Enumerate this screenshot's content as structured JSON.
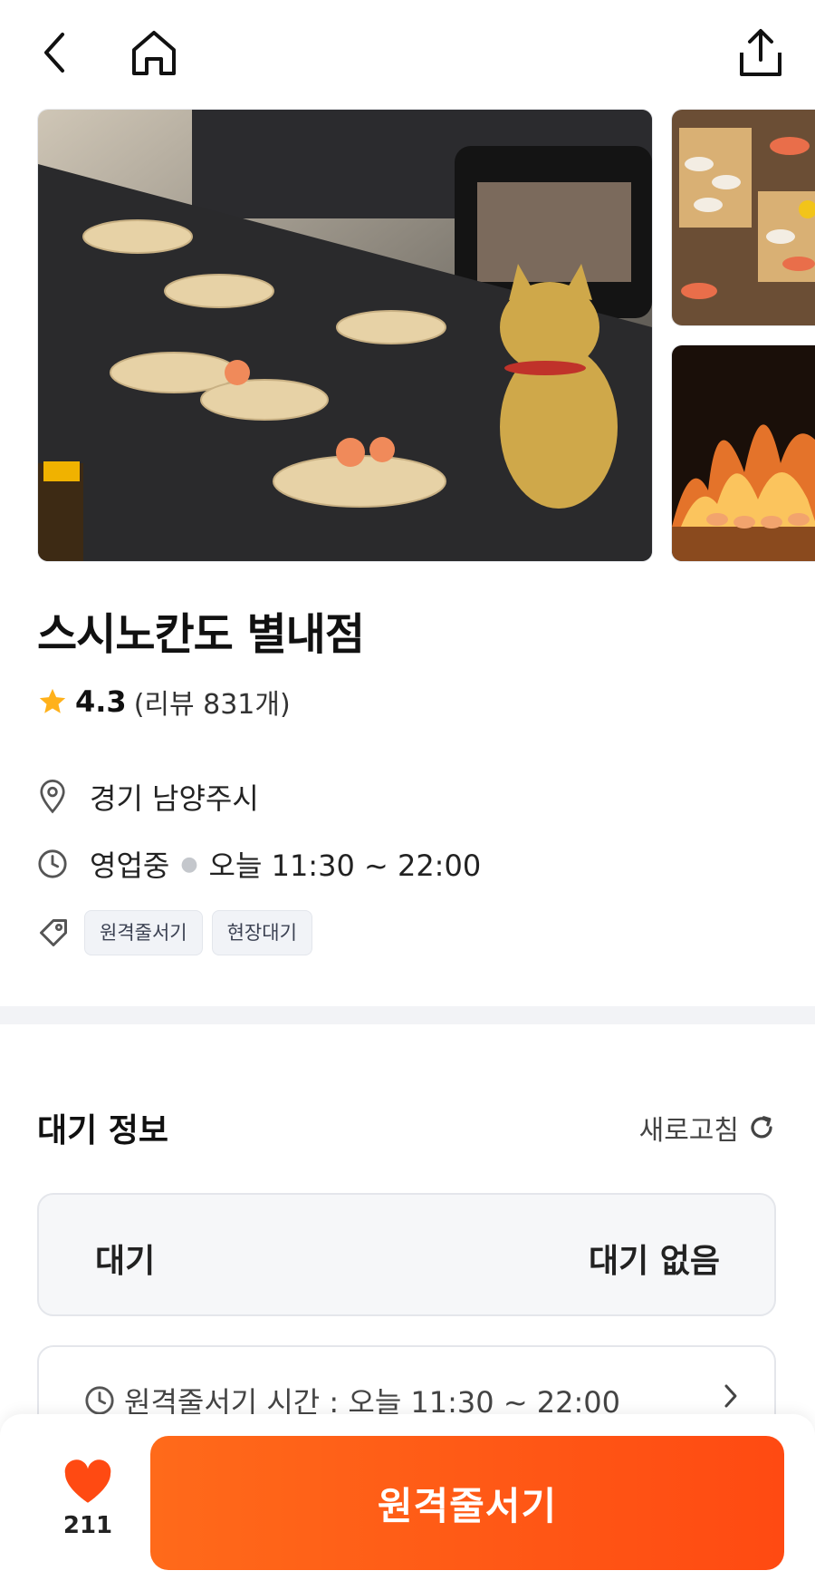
{
  "header": {
    "back_icon": "chevron-left-icon",
    "home_icon": "home-icon",
    "share_icon": "share-icon"
  },
  "gallery": {
    "images": [
      "conveyor-sushi-with-lucky-cat",
      "sushi-platter",
      "flame-grilled-shrimp"
    ]
  },
  "store": {
    "name": "스시노칸도 별내점",
    "rating": "4.3",
    "review_count": "(리뷰 831개)",
    "location": "경기 남양주시",
    "status": "영업중",
    "hours": "오늘 11:30 ~ 22:00",
    "tags": [
      "원격줄서기",
      "현장대기"
    ]
  },
  "wait_info": {
    "title": "대기 정보",
    "refresh_label": "새로고침",
    "wait_label": "대기",
    "wait_value": "대기 없음",
    "remote_hours": "원격줄서기 시간 : 오늘 11:30 ~ 22:00"
  },
  "bottom": {
    "like_count": "211",
    "cta_label": "원격줄서기"
  },
  "colors": {
    "accent": "#ff5a16",
    "star": "#ffb11b",
    "heart": "#ff4a12"
  }
}
